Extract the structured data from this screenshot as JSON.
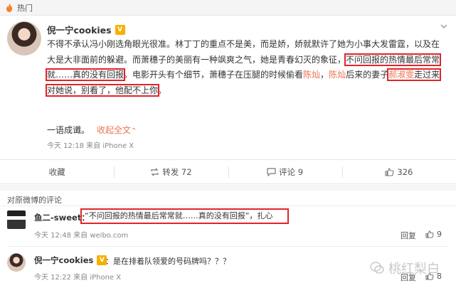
{
  "topbar": {
    "label": "热门",
    "icon": "fire-icon"
  },
  "post": {
    "username": "倪一宁cookies",
    "badge": "V",
    "text_1": "不得不承认冯小刚选角眼光很准。林丁丁的重点不是美，而是娇，娇就默许了她为小事大发雷霆，以及在大是大非面前的躲避。而萧穗子的美丽有一种飒爽之气，她是青春幻灭的象征，",
    "text_boxed": "不问回报的热情最后常常就……真的没有回报",
    "text_2": "。电影开头有个细节，萧穗子在压腿的时候偷看",
    "name_1": "陈灿",
    "sep": "，",
    "name_2": "陈灿",
    "text_3": "后来的妻子",
    "name_3": "郝淑雯",
    "text_4": "走过来对她说，别看了，他配不上你",
    "text_5": "。",
    "summary": "一语成谶。",
    "collapse": "收起全文",
    "collapse_arrow": "⌃",
    "meta": "今天 12:18 来自 iPhone X"
  },
  "actions": {
    "favorite": "收藏",
    "repost": "转发 72",
    "comment": "评论 9",
    "like": "326"
  },
  "comments": {
    "header": "对原微博的评论",
    "c1": {
      "name": "鱼二-sweet",
      "colon": "：",
      "text": "“不问回报的热情最后常常就……真的没有回报”，扎心",
      "meta": "今天 12:48 来自 weibo.com",
      "reply": "回复",
      "likes": "9"
    },
    "c2": {
      "name": "倪一宁cookies",
      "badge": "V",
      "text": "：是在排着队领爱的号码牌吗？？？",
      "meta": "今天 12:22 来自 iPhone X",
      "reply": "回复",
      "likes": "8"
    }
  },
  "watermark": "桃红梨白",
  "colors": {
    "accent": "#eb7350",
    "highlight_box": "#e3232a",
    "badge": "#f6b000"
  }
}
